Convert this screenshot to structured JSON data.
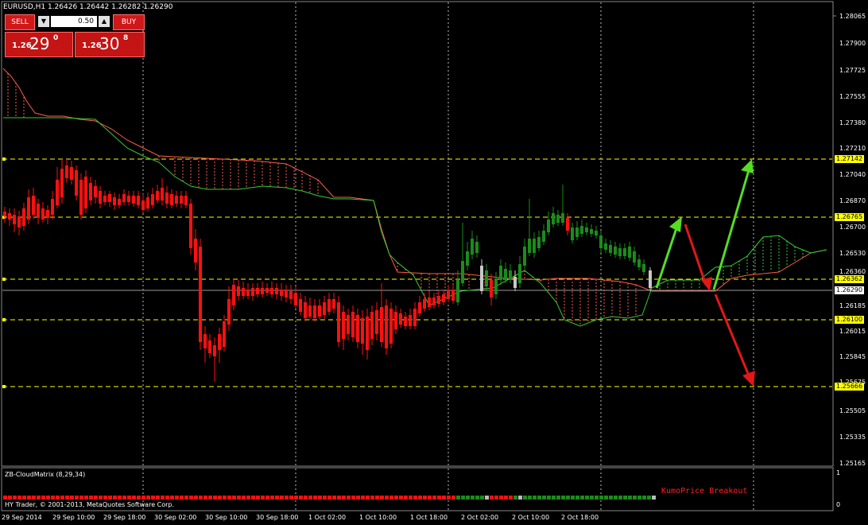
{
  "symbol_header": "EURUSD,H1  1.26426 1.26442 1.26282 1.26290",
  "trade_panel": {
    "sell_label": "SELL",
    "buy_label": "BUY",
    "lot_value": "0.50",
    "sell_small": "1.26",
    "sell_big": "29",
    "sell_sup": "0",
    "buy_small": "1.26",
    "buy_big": "30",
    "buy_sup": "8"
  },
  "price_axis": [
    "1.28065",
    "1.27900",
    "1.27725",
    "1.27555",
    "1.27380",
    "1.27210",
    "1.27040",
    "1.26870",
    "1.26700",
    "1.26530",
    "1.26360",
    "1.26185",
    "1.26015",
    "1.25845",
    "1.25675",
    "1.25505",
    "1.25335",
    "1.25165"
  ],
  "level_labels": [
    "1.27142",
    "1.26765",
    "1.26362",
    "1.26100",
    "1.25666"
  ],
  "current_price": "1.26290",
  "time_axis": [
    "29 Sep 2014",
    "29 Sep 10:00",
    "29 Sep 18:00",
    "30 Sep 02:00",
    "30 Sep 10:00",
    "30 Sep 18:00",
    "1 Oct 02:00",
    "1 Oct 10:00",
    "1 Oct 18:00",
    "2 Oct 02:00",
    "2 Oct 10:00",
    "2 Oct 18:00"
  ],
  "indicator": {
    "title": "ZB-CloudMatrix (8,29,34)",
    "annotation": "KumoPrice Breakout",
    "axis_top": "1",
    "axis_bottom": "0"
  },
  "copyright": "HY Trader, © 2001-2013, MetaQuotes Software Corp.",
  "colors": {
    "bull": "#1a8c1a",
    "bear": "#ff1010",
    "level_line": "#ffff00",
    "arrow_up": "#55dd22",
    "arrow_down": "#e01818"
  },
  "chart_data": {
    "type": "candlestick",
    "symbol": "EURUSD",
    "timeframe": "H1",
    "ohlc": {
      "open": 1.26426,
      "high": 1.26442,
      "low": 1.26282,
      "close": 1.2629
    },
    "horizontal_levels": [
      1.27142,
      1.26765,
      1.26362,
      1.261,
      1.25666
    ],
    "ylim": [
      1.25165,
      1.28065
    ]
  }
}
